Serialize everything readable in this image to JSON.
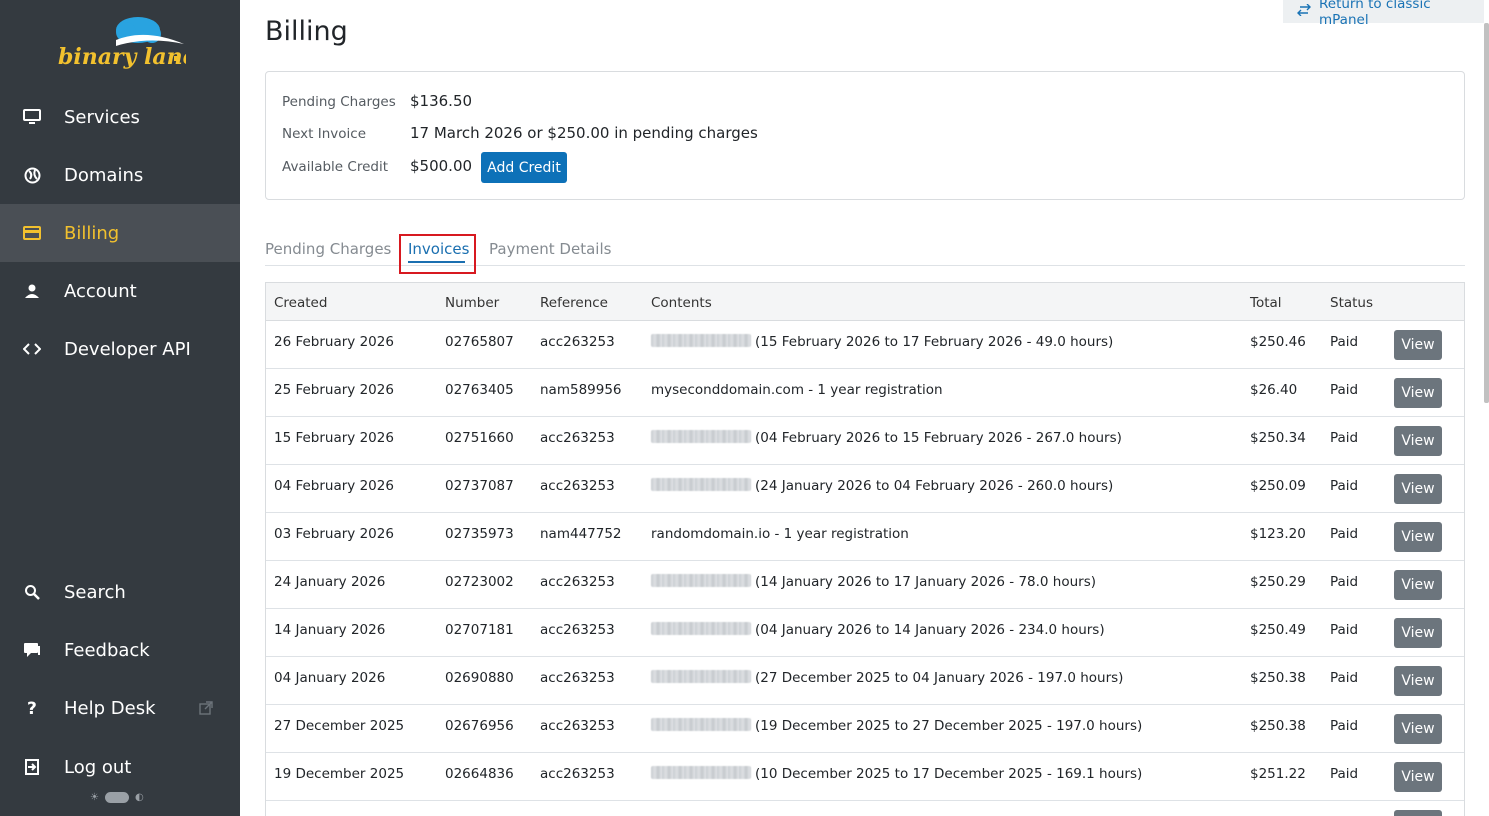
{
  "brand": {
    "logo_text": "binary lane"
  },
  "sidebar": {
    "items": [
      {
        "label": "Services",
        "icon": "monitor-icon"
      },
      {
        "label": "Domains",
        "icon": "globe-icon"
      },
      {
        "label": "Billing",
        "icon": "credit-card-icon",
        "active": true
      },
      {
        "label": "Account",
        "icon": "user-icon"
      },
      {
        "label": "Developer API",
        "icon": "code-icon"
      }
    ],
    "bottom_items": [
      {
        "label": "Search",
        "icon": "search-icon"
      },
      {
        "label": "Feedback",
        "icon": "feedback-icon"
      },
      {
        "label": "Help Desk",
        "icon": "question-icon",
        "external": true
      },
      {
        "label": "Log out",
        "icon": "logout-icon"
      }
    ]
  },
  "header": {
    "classic_link": "Return to classic mPanel",
    "title": "Billing"
  },
  "summary": {
    "pending_label": "Pending Charges",
    "pending_value": "$136.50",
    "next_invoice_label": "Next Invoice",
    "next_invoice_value": "17 March 2026 or $250.00 in pending charges",
    "credit_label": "Available Credit",
    "credit_value": "$500.00",
    "add_credit_button": "Add Credit"
  },
  "tabs": [
    "Pending Charges",
    "Invoices",
    "Payment Details"
  ],
  "active_tab": "Invoices",
  "table": {
    "headers": [
      "Created",
      "Number",
      "Reference",
      "Contents",
      "Total",
      "Status"
    ],
    "view_label": "View",
    "rows": [
      {
        "created": "26 February 2026",
        "number": "02765807",
        "reference": "acc263253",
        "redacted": true,
        "contents": "(15 February 2026 to 17 February 2026 - 49.0 hours)",
        "total": "$250.46",
        "status": "Paid"
      },
      {
        "created": "25 February 2026",
        "number": "02763405",
        "reference": "nam589956",
        "redacted": false,
        "contents": "myseconddomain.com - 1 year registration",
        "total": "$26.40",
        "status": "Paid"
      },
      {
        "created": "15 February 2026",
        "number": "02751660",
        "reference": "acc263253",
        "redacted": true,
        "contents": "(04 February 2026 to 15 February 2026 - 267.0 hours)",
        "total": "$250.34",
        "status": "Paid"
      },
      {
        "created": "04 February 2026",
        "number": "02737087",
        "reference": "acc263253",
        "redacted": true,
        "contents": "(24 January 2026 to 04 February 2026 - 260.0 hours)",
        "total": "$250.09",
        "status": "Paid"
      },
      {
        "created": "03 February 2026",
        "number": "02735973",
        "reference": "nam447752",
        "redacted": false,
        "contents": "randomdomain.io - 1 year registration",
        "total": "$123.20",
        "status": "Paid"
      },
      {
        "created": "24 January 2026",
        "number": "02723002",
        "reference": "acc263253",
        "redacted": true,
        "contents": "(14 January 2026 to 17 January 2026 - 78.0 hours)",
        "total": "$250.29",
        "status": "Paid"
      },
      {
        "created": "14 January 2026",
        "number": "02707181",
        "reference": "acc263253",
        "redacted": true,
        "contents": "(04 January 2026 to 14 January 2026 - 234.0 hours)",
        "total": "$250.49",
        "status": "Paid"
      },
      {
        "created": "04 January 2026",
        "number": "02690880",
        "reference": "acc263253",
        "redacted": true,
        "contents": "(27 December 2025 to 04 January 2026 - 197.0 hours)",
        "total": "$250.38",
        "status": "Paid"
      },
      {
        "created": "27 December 2025",
        "number": "02676956",
        "reference": "acc263253",
        "redacted": true,
        "contents": "(19 December 2025 to 27 December 2025 - 197.0 hours)",
        "total": "$250.38",
        "status": "Paid"
      },
      {
        "created": "19 December 2025",
        "number": "02664836",
        "reference": "acc263253",
        "redacted": true,
        "contents": "(10 December 2025 to 17 December 2025 - 169.1 hours)",
        "total": "$251.22",
        "status": "Paid"
      },
      {
        "created": "",
        "number": "",
        "reference": "",
        "redacted": false,
        "contents": "",
        "total": "",
        "status": ""
      }
    ]
  },
  "colors": {
    "sidebar_bg": "#343a40",
    "active_accent": "#f2c12e",
    "primary": "#0d71b8",
    "highlight_box": "#d71920"
  }
}
